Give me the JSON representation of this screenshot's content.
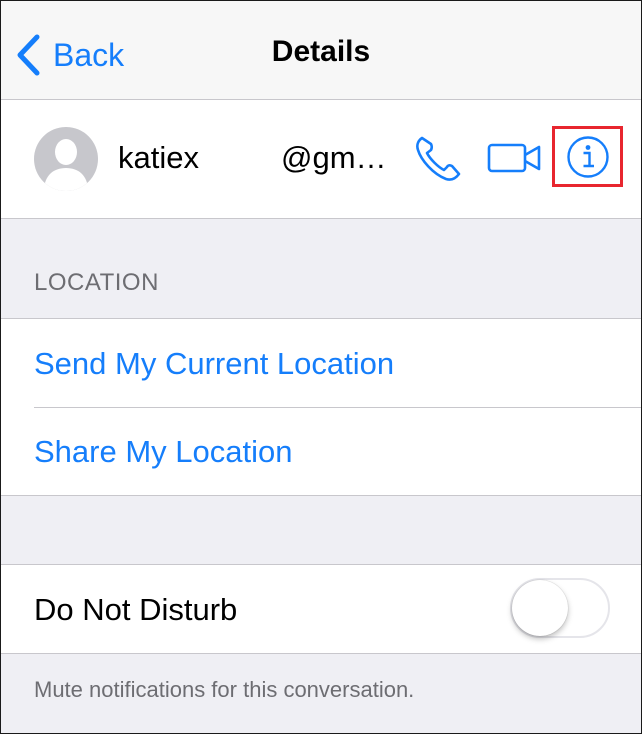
{
  "nav": {
    "back_label": "Back",
    "title": "Details"
  },
  "contact": {
    "name": "katiex",
    "email": "@gm…",
    "avatar_icon": "person-silhouette-icon",
    "actions": [
      {
        "icon": "phone-icon"
      },
      {
        "icon": "video-camera-icon"
      },
      {
        "icon": "info-icon",
        "highlighted": true
      }
    ]
  },
  "location": {
    "header": "LOCATION",
    "items": [
      {
        "label": "Send My Current Location"
      },
      {
        "label": "Share My Location"
      }
    ]
  },
  "do_not_disturb": {
    "label": "Do Not Disturb",
    "enabled": false,
    "footer": "Mute notifications for this conversation."
  },
  "colors": {
    "accent": "#157efb",
    "highlight_box": "#e8262f",
    "group_background": "#efeff4",
    "secondary_text": "#6d6d72"
  }
}
